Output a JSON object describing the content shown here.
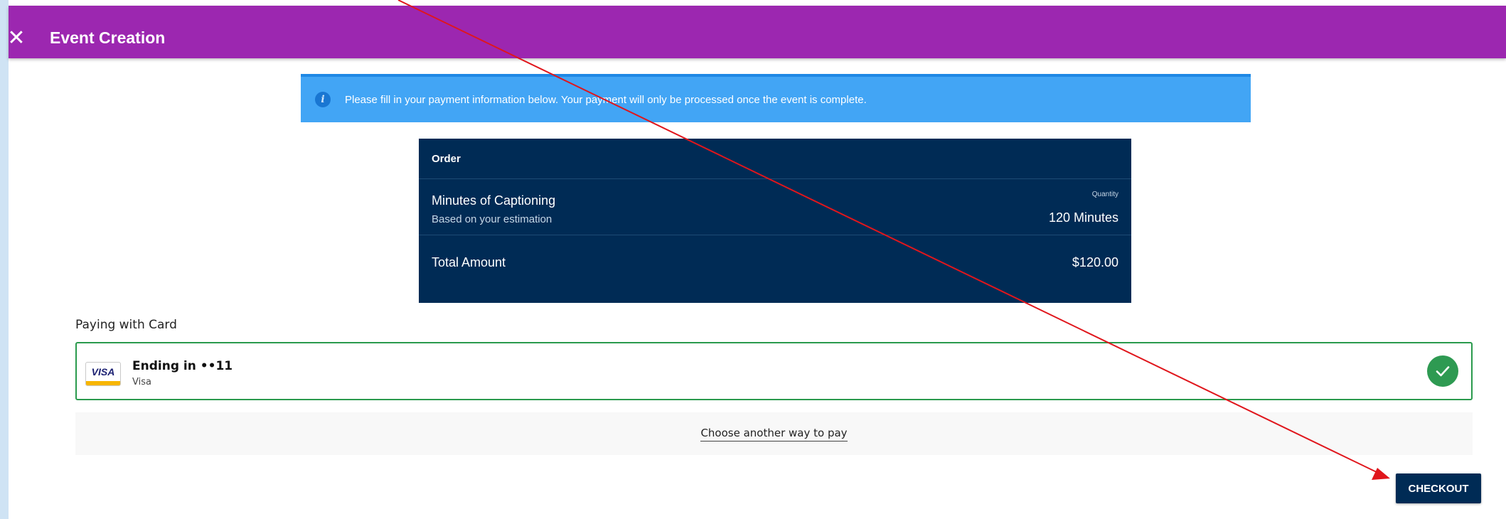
{
  "header": {
    "close_glyph": "✕",
    "title": "Event Creation",
    "background": "#9c27b0"
  },
  "info_banner": {
    "icon": "info-icon",
    "text": "Please fill in your payment information below. Your payment will only be processed once the event is complete."
  },
  "order": {
    "heading": "Order",
    "item_title": "Minutes of Captioning",
    "item_subtitle": "Based on your estimation",
    "quantity_label": "Quantity",
    "quantity_value": "120 Minutes",
    "total_label": "Total Amount",
    "total_value": "$120.00",
    "background": "#002b55"
  },
  "payment": {
    "section_label": "Paying with Card",
    "card_logo_text": "VISA",
    "card_title": "Ending in ••11",
    "card_brand": "Visa",
    "selected_color": "#2e9a52",
    "other_method_link": "Choose another way to pay"
  },
  "checkout": {
    "label": "CHECKOUT"
  },
  "annotation": {
    "color": "#e0161c",
    "icon": "arrow-annotation-icon"
  }
}
